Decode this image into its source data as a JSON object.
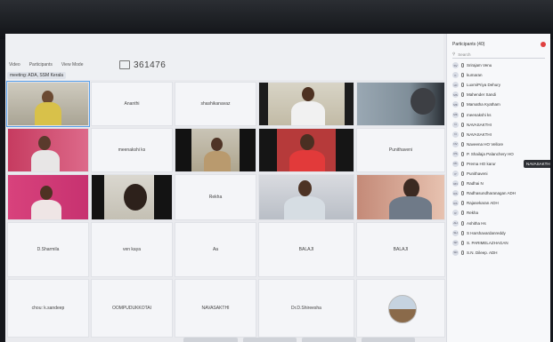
{
  "toolbar": {
    "items": [
      "Video",
      "Participants",
      "View Mode"
    ],
    "meeting_name": "meeting: ADA, SSM Kerala",
    "meeting_id": "361476"
  },
  "grid": {
    "names": {
      "r1c2": "Ananthi",
      "r1c3": "shashikanavaz",
      "r2c2": "meenakshi ks",
      "r2c5": "Punithaveni",
      "r3c3": "Rekha",
      "r4c1": "D.Sharmila",
      "r4c2": "ven kaya",
      "r4c3": "Aa",
      "r4c4": "BALAJI",
      "r4c5": "BALAJI",
      "r5c1": "chou: k.sandeep",
      "r5c2": "OOMPUDUKKOTAI",
      "r5c3": "NAVASAKTHI",
      "r5c4": "Dr.D.Shireesha"
    }
  },
  "participants": {
    "title": "Participants (40)",
    "search_placeholder": "Search",
    "tooltip": "NAVASAKTHI",
    "list": [
      {
        "init": "SV",
        "name": "Srirajam Venu"
      },
      {
        "init": "K",
        "name": "kumaran"
      },
      {
        "init": "LD",
        "name": "LuxmiPriya Dehury"
      },
      {
        "init": "MS",
        "name": "Mahender Sandi"
      },
      {
        "init": "MK",
        "name": "Mamatha Kyatham"
      },
      {
        "init": "MK",
        "name": "meenakshi ks"
      },
      {
        "init": "N",
        "name": "NAVASAKTHI"
      },
      {
        "init": "N",
        "name": "NAVASAKTHI"
      },
      {
        "init": "NV",
        "name": "Naveena HO Vellore"
      },
      {
        "init": "PS",
        "name": "P. Shailaja Palanchery HO"
      },
      {
        "init": "PK",
        "name": "Prema HO karur"
      },
      {
        "init": "P",
        "name": "Punithaveni"
      },
      {
        "init": "RN",
        "name": "Radhai N"
      },
      {
        "init": "RA",
        "name": "Radhasundharanagan ADH"
      },
      {
        "init": "RA",
        "name": "Rajasekaran ADH"
      },
      {
        "init": "R",
        "name": "Rekha"
      },
      {
        "init": "AH",
        "name": "Ashitha Hs"
      },
      {
        "init": "SH",
        "name": "S Harshavardanreddy"
      },
      {
        "init": "SP",
        "name": "S. PARIMELAZHAGAN"
      },
      {
        "init": "SD",
        "name": "S.N. Dileep. ADH"
      }
    ]
  },
  "colors": {
    "accent": "#5aa0e8",
    "panel_bg": "#f7f8fa",
    "tile_bg": "#f4f5f8"
  }
}
